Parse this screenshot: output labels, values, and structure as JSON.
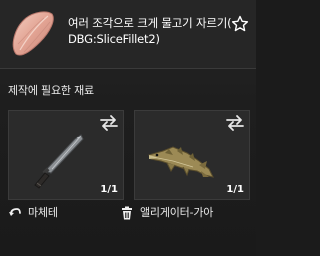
{
  "header": {
    "title": "여러 조각으로 크게 물고기 자르기( DBG:SliceFillet2)",
    "thumbnail_icon": "fish-fillet-icon",
    "favorite_icon": "star-outline-icon"
  },
  "materials": {
    "title": "제작에 필요한 재료",
    "items": [
      {
        "name": "마체테",
        "count": "1/1",
        "image_icon": "machete-icon",
        "label_icon": "return-arrow-icon",
        "swap_icon": "swap-arrows-icon"
      },
      {
        "name": "앨리게이터-가아",
        "count": "1/1",
        "image_icon": "alligator-gar-icon",
        "label_icon": "trash-icon",
        "swap_icon": "swap-arrows-icon"
      }
    ]
  },
  "colors": {
    "background": "#1b1b1b",
    "card": "#2b2b2b",
    "text": "#f2f2f2"
  }
}
